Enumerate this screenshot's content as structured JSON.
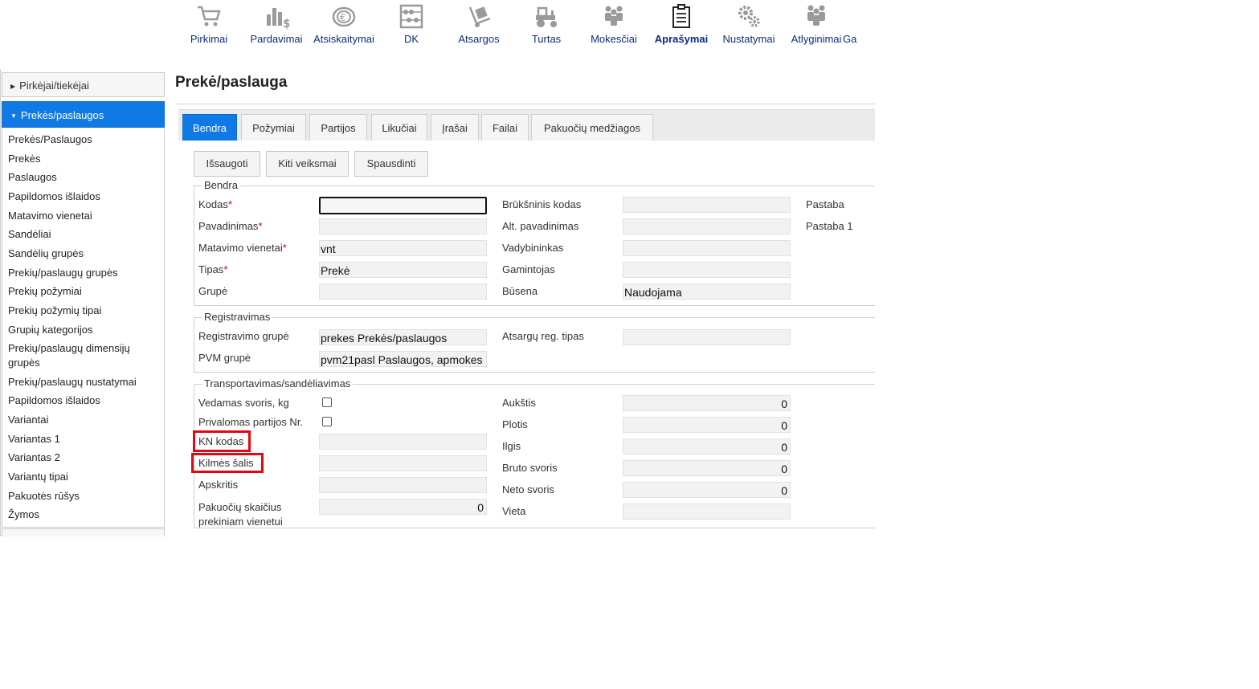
{
  "top_nav": [
    {
      "label": "Pirkimai",
      "icon": "shopping-cart-icon"
    },
    {
      "label": "Pardavimai",
      "icon": "sales-chart-icon"
    },
    {
      "label": "Atsiskaitymai",
      "icon": "coins-euro-icon"
    },
    {
      "label": "DK",
      "icon": "abacus-icon"
    },
    {
      "label": "Atsargos",
      "icon": "hand-truck-icon"
    },
    {
      "label": "Turtas",
      "icon": "tractor-icon"
    },
    {
      "label": "Mokesčiai",
      "icon": "people-icon"
    },
    {
      "label": "Aprašymai",
      "icon": "clipboard-icon",
      "active": true
    },
    {
      "label": "Nustatymai",
      "icon": "gears-icon"
    },
    {
      "label": "Atlyginimai",
      "icon": "employees-icon"
    },
    {
      "label": "Ga",
      "icon": "more-icon"
    }
  ],
  "sidebar": {
    "collapsed_section": "Pirkėjai/tiekėjai",
    "open_section": "Prekės/paslaugos",
    "items": [
      "Prekės/Paslaugos",
      "Prekės",
      "Paslaugos",
      "Papildomos išlaidos",
      "Matavimo vienetai",
      "Sandėliai",
      "Sandėlių grupės",
      "Prekių/paslaugų grupės",
      "Prekių požymiai",
      "Prekių požymių tipai",
      "Grupių kategorijos",
      "Prekių/paslaugų dimensijų grupės",
      "Prekių/paslaugų nustatymai",
      "Papildomos išlaidos",
      "Variantai",
      "Variantas 1",
      "Variantas 2",
      "Variantų tipai",
      "Pakuotės rūšys",
      "Žymos"
    ]
  },
  "page_title": "Prekė/paslauga",
  "tabs": [
    "Bendra",
    "Požymiai",
    "Partijos",
    "Likučiai",
    "Įrašai",
    "Failai",
    "Pakuočių medžiagos"
  ],
  "toolbar": {
    "save": "Išsaugoti",
    "other_actions": "Kiti veiksmai",
    "print": "Spausdinti"
  },
  "general": {
    "legend": "Bendra",
    "kodas": {
      "label": "Kodas",
      "value": ""
    },
    "pavadinimas": {
      "label": "Pavadinimas",
      "value": ""
    },
    "matavimo_vienetai": {
      "label": "Matavimo vienetai",
      "value": "vnt"
    },
    "tipas": {
      "label": "Tipas",
      "value": "Prekė"
    },
    "grupe": {
      "label": "Grupė",
      "value": ""
    },
    "bruksninis_kodas": {
      "label": "Brūkšninis kodas",
      "value": ""
    },
    "alt_pavadinimas": {
      "label": "Alt. pavadinimas",
      "value": ""
    },
    "vadybininkas": {
      "label": "Vadybininkas",
      "value": ""
    },
    "gamintojas": {
      "label": "Gamintojas",
      "value": ""
    },
    "busena": {
      "label": "Būsena",
      "value": "Naudojama"
    },
    "pastaba": "Pastaba",
    "pastaba1": "Pastaba 1",
    "required_mark": "*"
  },
  "registration": {
    "legend": "Registravimas",
    "reg_grupe": {
      "label": "Registravimo grupė",
      "value": "prekes Prekės/paslaugos"
    },
    "pvm_grupe": {
      "label": "PVM grupė",
      "value": "pvm21pasl Paslaugos, apmokes"
    },
    "atsargu_reg_tipas": {
      "label": "Atsargų reg. tipas",
      "value": ""
    }
  },
  "transport": {
    "legend": "Transportavimas/sandėliavimas",
    "vedamas_svoris": {
      "label": "Vedamas svoris, kg",
      "checked": false
    },
    "privalomas_partijos": {
      "label": "Privalomas partijos Nr.",
      "checked": false
    },
    "kn_kodas": {
      "label": "KN kodas",
      "value": ""
    },
    "kilmes_salis": {
      "label": "Kilmės šalis",
      "value": ""
    },
    "apskritis": {
      "label": "Apskritis",
      "value": ""
    },
    "pakuociu_skaicius": {
      "label": "Pakuočių skaičius prekiniam vienetui",
      "value": "0"
    },
    "aukstis": {
      "label": "Aukštis",
      "value": "0"
    },
    "plotis": {
      "label": "Plotis",
      "value": "0"
    },
    "ilgis": {
      "label": "Ilgis",
      "value": "0"
    },
    "bruto_svoris": {
      "label": "Bruto svoris",
      "value": "0"
    },
    "neto_svoris": {
      "label": "Neto svoris",
      "value": "0"
    },
    "vieta": {
      "label": "Vieta",
      "value": ""
    }
  },
  "colors": {
    "accent": "#0f7ae5",
    "nav_text": "#0b2e7d",
    "highlight": "#e30613",
    "icon": "#9a9a9a"
  }
}
